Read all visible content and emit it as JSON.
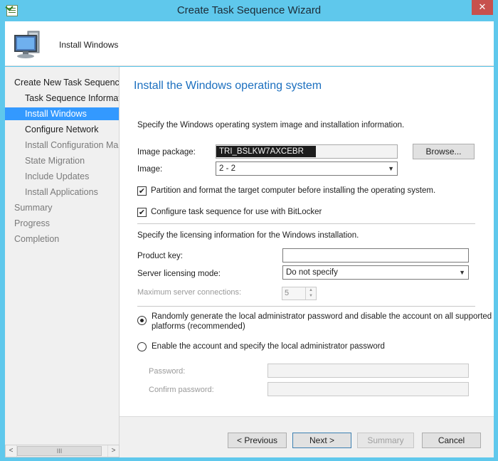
{
  "window": {
    "title": "Create Task Sequence Wizard",
    "close_glyph": "✕"
  },
  "header": {
    "title": "Install Windows",
    "icon": "computer-monitor-icon"
  },
  "nav": {
    "items": [
      {
        "label": "Create New Task Sequence",
        "state": "normal"
      },
      {
        "label": "Task Sequence Information",
        "state": "normal"
      },
      {
        "label": "Install Windows",
        "state": "selected"
      },
      {
        "label": "Configure Network",
        "state": "normal"
      },
      {
        "label": "Install Configuration Manager",
        "state": "dim"
      },
      {
        "label": "State Migration",
        "state": "dim"
      },
      {
        "label": "Include Updates",
        "state": "dim"
      },
      {
        "label": "Install Applications",
        "state": "dim"
      },
      {
        "label": "Summary",
        "state": "dim"
      },
      {
        "label": "Progress",
        "state": "dim"
      },
      {
        "label": "Completion",
        "state": "dim"
      }
    ],
    "scroll": {
      "left_arrow": "<",
      "thumb_grip": "III",
      "right_arrow": ">"
    }
  },
  "main": {
    "title": "Install the Windows operating system",
    "instructions": "Specify the Windows operating system image and installation information.",
    "image_package": {
      "label": "Image package:",
      "value": "TRI_BSLKW7AXCEBR",
      "browse_label": "Browse..."
    },
    "image": {
      "label": "Image:",
      "value": "2 - 2"
    },
    "partition": {
      "label": "Partition and format the target computer before installing the operating system.",
      "checked": true
    },
    "bitlocker": {
      "label": "Configure task sequence for use with BitLocker",
      "checked": true
    },
    "licensing_intro": "Specify the licensing information for the Windows installation.",
    "product_key": {
      "label": "Product key:",
      "value": ""
    },
    "licensing_mode": {
      "label": "Server licensing mode:",
      "value": "Do not specify"
    },
    "max_connections": {
      "label": "Maximum server connections:",
      "value": "5"
    },
    "radio_random": {
      "label": "Randomly generate the local administrator password and disable the account on all supported platforms (recommended)",
      "line1": "Randomly generate the local administrator password and disable the account on all supported",
      "line2": "platforms (recommended)",
      "selected": true
    },
    "radio_enable": {
      "label": "Enable the account and specify the local administrator password",
      "selected": false
    },
    "password": {
      "label": "Password:",
      "value": ""
    },
    "confirm_password": {
      "label": "Confirm password:",
      "value": ""
    }
  },
  "footer": {
    "previous_label": "< Previous",
    "next_label": "Next >",
    "summary_label": "Summary",
    "cancel_label": "Cancel"
  },
  "colors": {
    "title_bar": "#5fc8ec",
    "close_button": "#c7514d",
    "selection": "#3399ff",
    "heading": "#1b6fbf"
  }
}
